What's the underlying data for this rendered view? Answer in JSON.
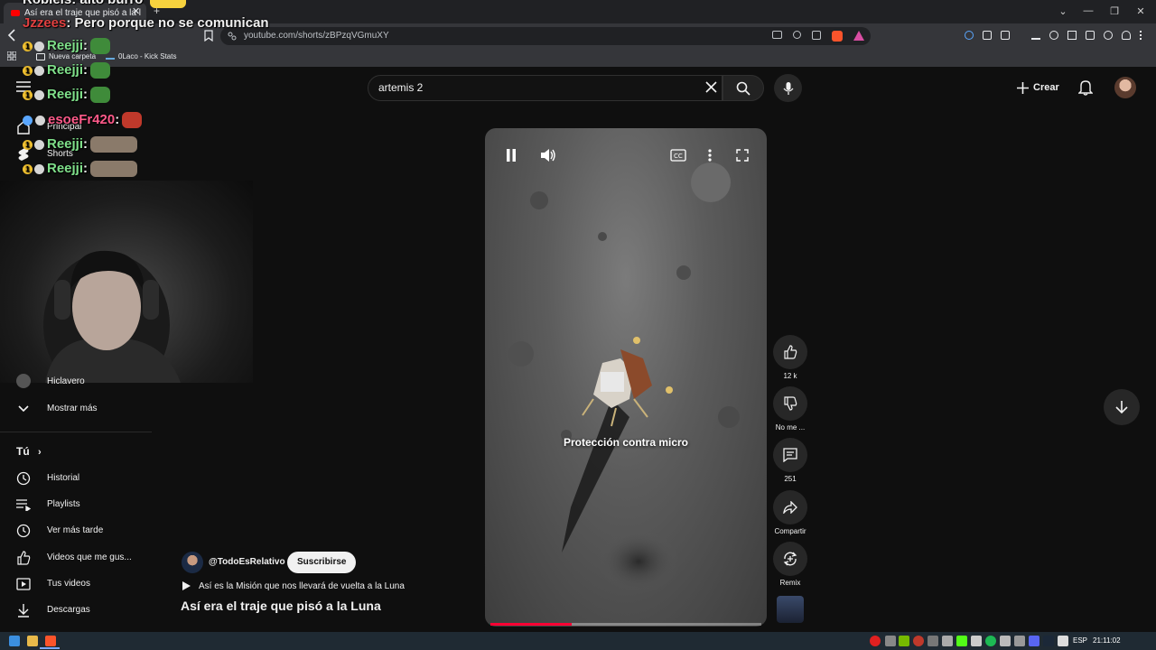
{
  "browser": {
    "tab_title": "Así era el traje que pisó a la l",
    "url": "youtube.com/shorts/zBPzqVGmuXY",
    "bookmarks": [
      "Nueva carpeta",
      "0Laco - Kick Stats"
    ]
  },
  "header": {
    "search_query": "artemis 2",
    "create_label": "Crear"
  },
  "sidebar": {
    "home_label": "Principal",
    "shorts_label": "Shorts",
    "partial_item_label": "Hiclavero",
    "show_more_label": "Mostrar más",
    "you_label": "Tú",
    "items": [
      {
        "label": "Historial",
        "icon": "history-icon"
      },
      {
        "label": "Playlists",
        "icon": "playlists-icon"
      },
      {
        "label": "Ver más tarde",
        "icon": "watch-later-icon"
      },
      {
        "label": "Videos que me gus...",
        "icon": "like-icon"
      },
      {
        "label": "Tus videos",
        "icon": "your-videos-icon"
      },
      {
        "label": "Descargas",
        "icon": "downloads-icon"
      }
    ]
  },
  "chat": [
    {
      "user": "Robleis",
      "text": ": alto burro",
      "color": "#f1f1f1"
    },
    {
      "user": "Jzzees",
      "text": ": Pero porque no se comunican",
      "color": "#e04040"
    },
    {
      "user": "Reejji",
      "text": ":",
      "color": "#7fe08a"
    },
    {
      "user": "Reejji",
      "text": ":",
      "color": "#7fe08a"
    },
    {
      "user": "Reejji",
      "text": ":",
      "color": "#7fe08a"
    },
    {
      "user": "esoeFr420",
      "text": ":",
      "color": "#ff5a8a"
    },
    {
      "user": "Reejji",
      "text": ":",
      "color": "#7fe08a"
    },
    {
      "user": "Reejji",
      "text": ":",
      "color": "#7fe08a"
    }
  ],
  "player": {
    "caption": "Protección contra micro",
    "progress": 0.3
  },
  "actions": {
    "likes": "12 k",
    "dislike_label": "No me ...",
    "comments": "251",
    "share_label": "Compartir",
    "remix_label": "Remix"
  },
  "channel": {
    "handle": "@TodoEsRelativo",
    "subscribe_label": "Suscribirse",
    "playlist_title": "Así es la Misión que nos llevará de vuelta a la Luna",
    "video_title": "Así era el traje que pisó a la Luna"
  },
  "taskbar": {
    "language": "ESP",
    "time": "21:11:02"
  },
  "colors": {
    "background": "#0f0f0f",
    "progress_red": "#ff0033",
    "accent": "#ff0000"
  }
}
